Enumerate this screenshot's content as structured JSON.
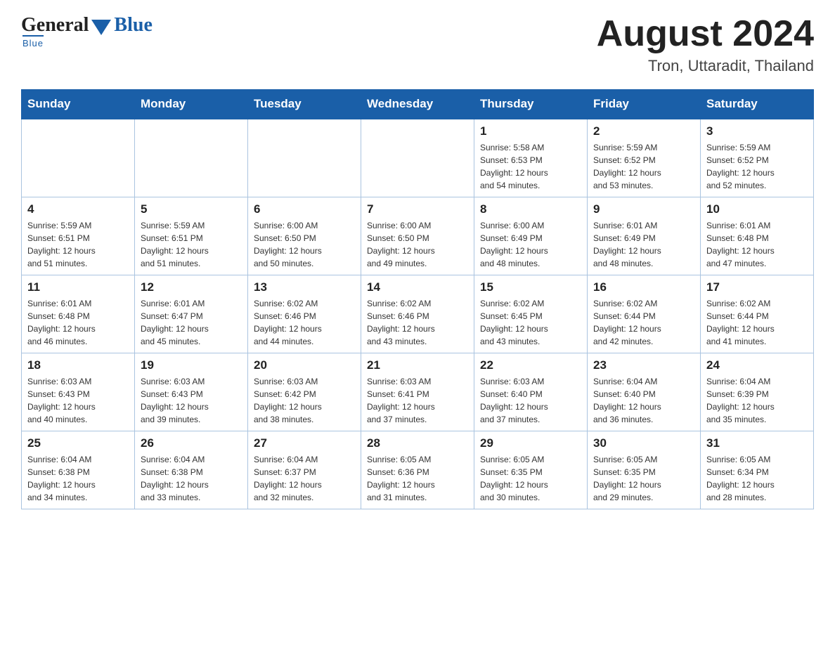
{
  "logo": {
    "general": "General",
    "blue": "Blue",
    "underline": "Blue"
  },
  "title": {
    "month_year": "August 2024",
    "location": "Tron, Uttaradit, Thailand"
  },
  "days_of_week": [
    "Sunday",
    "Monday",
    "Tuesday",
    "Wednesday",
    "Thursday",
    "Friday",
    "Saturday"
  ],
  "weeks": [
    [
      {
        "day": "",
        "info": ""
      },
      {
        "day": "",
        "info": ""
      },
      {
        "day": "",
        "info": ""
      },
      {
        "day": "",
        "info": ""
      },
      {
        "day": "1",
        "info": "Sunrise: 5:58 AM\nSunset: 6:53 PM\nDaylight: 12 hours\nand 54 minutes."
      },
      {
        "day": "2",
        "info": "Sunrise: 5:59 AM\nSunset: 6:52 PM\nDaylight: 12 hours\nand 53 minutes."
      },
      {
        "day": "3",
        "info": "Sunrise: 5:59 AM\nSunset: 6:52 PM\nDaylight: 12 hours\nand 52 minutes."
      }
    ],
    [
      {
        "day": "4",
        "info": "Sunrise: 5:59 AM\nSunset: 6:51 PM\nDaylight: 12 hours\nand 51 minutes."
      },
      {
        "day": "5",
        "info": "Sunrise: 5:59 AM\nSunset: 6:51 PM\nDaylight: 12 hours\nand 51 minutes."
      },
      {
        "day": "6",
        "info": "Sunrise: 6:00 AM\nSunset: 6:50 PM\nDaylight: 12 hours\nand 50 minutes."
      },
      {
        "day": "7",
        "info": "Sunrise: 6:00 AM\nSunset: 6:50 PM\nDaylight: 12 hours\nand 49 minutes."
      },
      {
        "day": "8",
        "info": "Sunrise: 6:00 AM\nSunset: 6:49 PM\nDaylight: 12 hours\nand 48 minutes."
      },
      {
        "day": "9",
        "info": "Sunrise: 6:01 AM\nSunset: 6:49 PM\nDaylight: 12 hours\nand 48 minutes."
      },
      {
        "day": "10",
        "info": "Sunrise: 6:01 AM\nSunset: 6:48 PM\nDaylight: 12 hours\nand 47 minutes."
      }
    ],
    [
      {
        "day": "11",
        "info": "Sunrise: 6:01 AM\nSunset: 6:48 PM\nDaylight: 12 hours\nand 46 minutes."
      },
      {
        "day": "12",
        "info": "Sunrise: 6:01 AM\nSunset: 6:47 PM\nDaylight: 12 hours\nand 45 minutes."
      },
      {
        "day": "13",
        "info": "Sunrise: 6:02 AM\nSunset: 6:46 PM\nDaylight: 12 hours\nand 44 minutes."
      },
      {
        "day": "14",
        "info": "Sunrise: 6:02 AM\nSunset: 6:46 PM\nDaylight: 12 hours\nand 43 minutes."
      },
      {
        "day": "15",
        "info": "Sunrise: 6:02 AM\nSunset: 6:45 PM\nDaylight: 12 hours\nand 43 minutes."
      },
      {
        "day": "16",
        "info": "Sunrise: 6:02 AM\nSunset: 6:44 PM\nDaylight: 12 hours\nand 42 minutes."
      },
      {
        "day": "17",
        "info": "Sunrise: 6:02 AM\nSunset: 6:44 PM\nDaylight: 12 hours\nand 41 minutes."
      }
    ],
    [
      {
        "day": "18",
        "info": "Sunrise: 6:03 AM\nSunset: 6:43 PM\nDaylight: 12 hours\nand 40 minutes."
      },
      {
        "day": "19",
        "info": "Sunrise: 6:03 AM\nSunset: 6:43 PM\nDaylight: 12 hours\nand 39 minutes."
      },
      {
        "day": "20",
        "info": "Sunrise: 6:03 AM\nSunset: 6:42 PM\nDaylight: 12 hours\nand 38 minutes."
      },
      {
        "day": "21",
        "info": "Sunrise: 6:03 AM\nSunset: 6:41 PM\nDaylight: 12 hours\nand 37 minutes."
      },
      {
        "day": "22",
        "info": "Sunrise: 6:03 AM\nSunset: 6:40 PM\nDaylight: 12 hours\nand 37 minutes."
      },
      {
        "day": "23",
        "info": "Sunrise: 6:04 AM\nSunset: 6:40 PM\nDaylight: 12 hours\nand 36 minutes."
      },
      {
        "day": "24",
        "info": "Sunrise: 6:04 AM\nSunset: 6:39 PM\nDaylight: 12 hours\nand 35 minutes."
      }
    ],
    [
      {
        "day": "25",
        "info": "Sunrise: 6:04 AM\nSunset: 6:38 PM\nDaylight: 12 hours\nand 34 minutes."
      },
      {
        "day": "26",
        "info": "Sunrise: 6:04 AM\nSunset: 6:38 PM\nDaylight: 12 hours\nand 33 minutes."
      },
      {
        "day": "27",
        "info": "Sunrise: 6:04 AM\nSunset: 6:37 PM\nDaylight: 12 hours\nand 32 minutes."
      },
      {
        "day": "28",
        "info": "Sunrise: 6:05 AM\nSunset: 6:36 PM\nDaylight: 12 hours\nand 31 minutes."
      },
      {
        "day": "29",
        "info": "Sunrise: 6:05 AM\nSunset: 6:35 PM\nDaylight: 12 hours\nand 30 minutes."
      },
      {
        "day": "30",
        "info": "Sunrise: 6:05 AM\nSunset: 6:35 PM\nDaylight: 12 hours\nand 29 minutes."
      },
      {
        "day": "31",
        "info": "Sunrise: 6:05 AM\nSunset: 6:34 PM\nDaylight: 12 hours\nand 28 minutes."
      }
    ]
  ]
}
